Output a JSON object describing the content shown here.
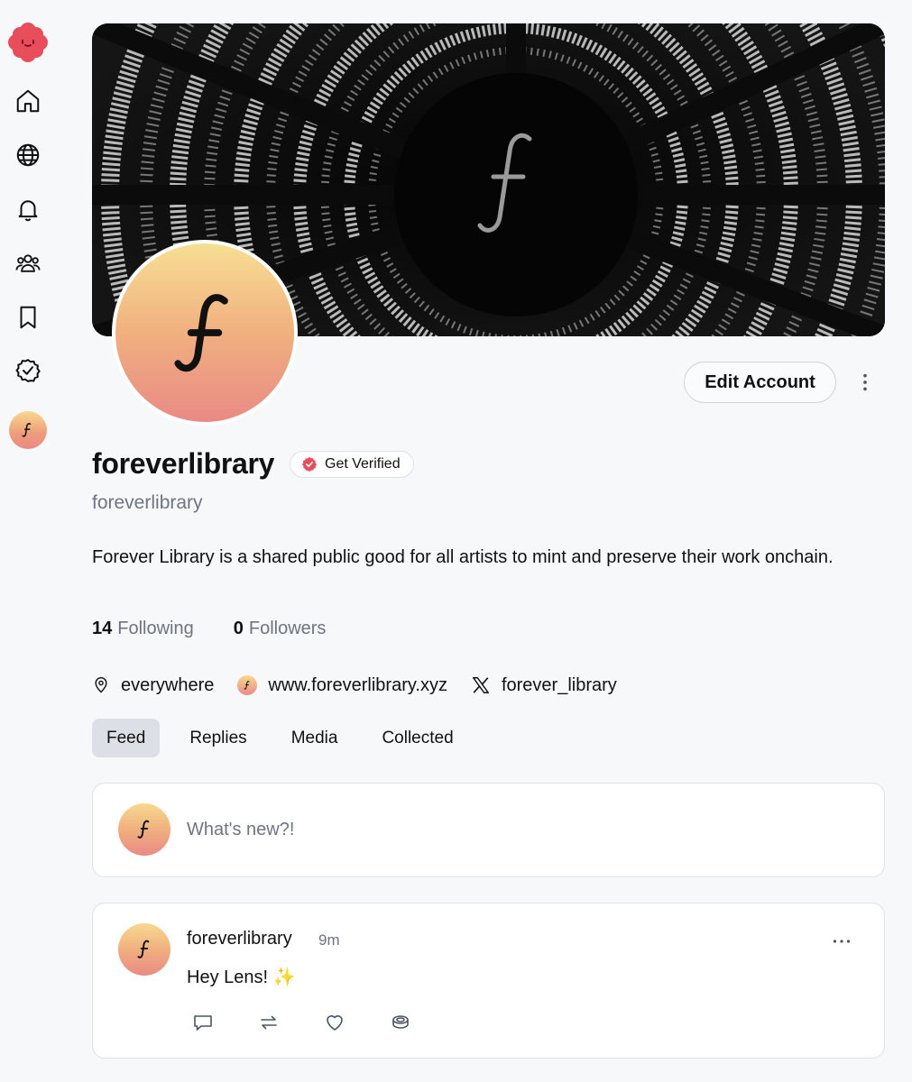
{
  "colors": {
    "accent": "#e84d5c",
    "muted": "#6e7481",
    "avatar_top": "#f7df94",
    "avatar_bottom": "#e98a85"
  },
  "sidebar": {
    "items": [
      {
        "icon": "app-logo-icon"
      },
      {
        "icon": "home-icon"
      },
      {
        "icon": "globe-icon"
      },
      {
        "icon": "bell-icon"
      },
      {
        "icon": "users-icon"
      },
      {
        "icon": "bookmark-icon"
      },
      {
        "icon": "verified-check-icon"
      },
      {
        "icon": "profile-avatar"
      }
    ]
  },
  "profile": {
    "display_name": "foreverlibrary",
    "verify_label": "Get Verified",
    "handle": "foreverlibrary",
    "bio": "Forever Library is a shared public good for all artists to mint and preserve their work onchain.",
    "following_count": "14",
    "following_label": "Following",
    "followers_count": "0",
    "followers_label": "Followers",
    "location": "everywhere",
    "website": "www.foreverlibrary.xyz",
    "x_handle": "forever_library",
    "edit_label": "Edit Account"
  },
  "tabs": [
    "Feed",
    "Replies",
    "Media",
    "Collected"
  ],
  "composer": {
    "placeholder": "What's new?!"
  },
  "post": {
    "author": "foreverlibrary",
    "time": "9m",
    "text": "Hey Lens! ✨"
  }
}
